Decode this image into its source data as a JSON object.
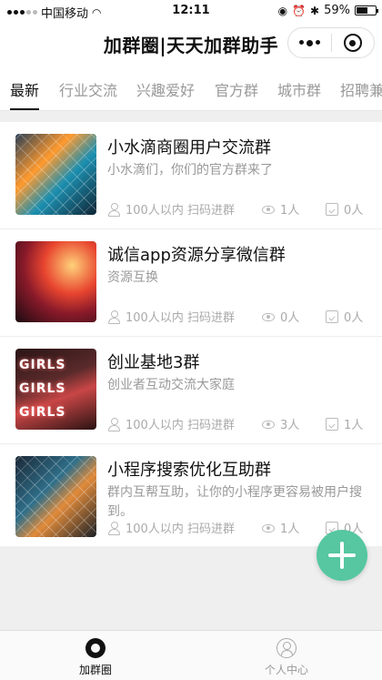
{
  "status_bar": {
    "carrier": "中国移动",
    "time": "12:11",
    "battery_percent": "59%",
    "battery_level": 0.59,
    "icons": [
      "signal-icon",
      "wifi-icon",
      "orientation-lock-icon",
      "alarm-icon",
      "bluetooth-icon",
      "battery-icon"
    ]
  },
  "navbar": {
    "title": "加群圈|天天加群助手",
    "more_icon": "more-dots-icon",
    "close_icon": "target-circle-icon"
  },
  "tabs": [
    {
      "label": "最新",
      "active": true
    },
    {
      "label": "行业交流"
    },
    {
      "label": "兴趣爱好"
    },
    {
      "label": "官方群"
    },
    {
      "label": "城市群"
    },
    {
      "label": "招聘兼职"
    }
  ],
  "groups": [
    {
      "title": "小水滴商圈用户交流群",
      "desc": "小水滴们，你们的官方群来了",
      "size": "100人以内 扫码进群",
      "views": "1人",
      "joins": "0人"
    },
    {
      "title": "诚信app资源分享微信群",
      "desc": "资源互换",
      "size": "100人以内 扫码进群",
      "views": "0人",
      "joins": "0人"
    },
    {
      "title": "创业基地3群",
      "desc": "创业者互动交流大家庭",
      "size": "100人以内 扫码进群",
      "views": "3人",
      "joins": "1人"
    },
    {
      "title": "小程序搜索优化互助群",
      "desc": "群内互帮互助，让你的小程序更容易被用户搜到。",
      "size": "100人以内 扫码进群",
      "views": "1人",
      "joins": "0人"
    }
  ],
  "thumbnail_text": {
    "neon": "GIRLS"
  },
  "fab": {
    "icon": "plus-icon",
    "color": "#56c7a0"
  },
  "tabbar": {
    "home_label": "加群圈",
    "user_label": "个人中心"
  }
}
